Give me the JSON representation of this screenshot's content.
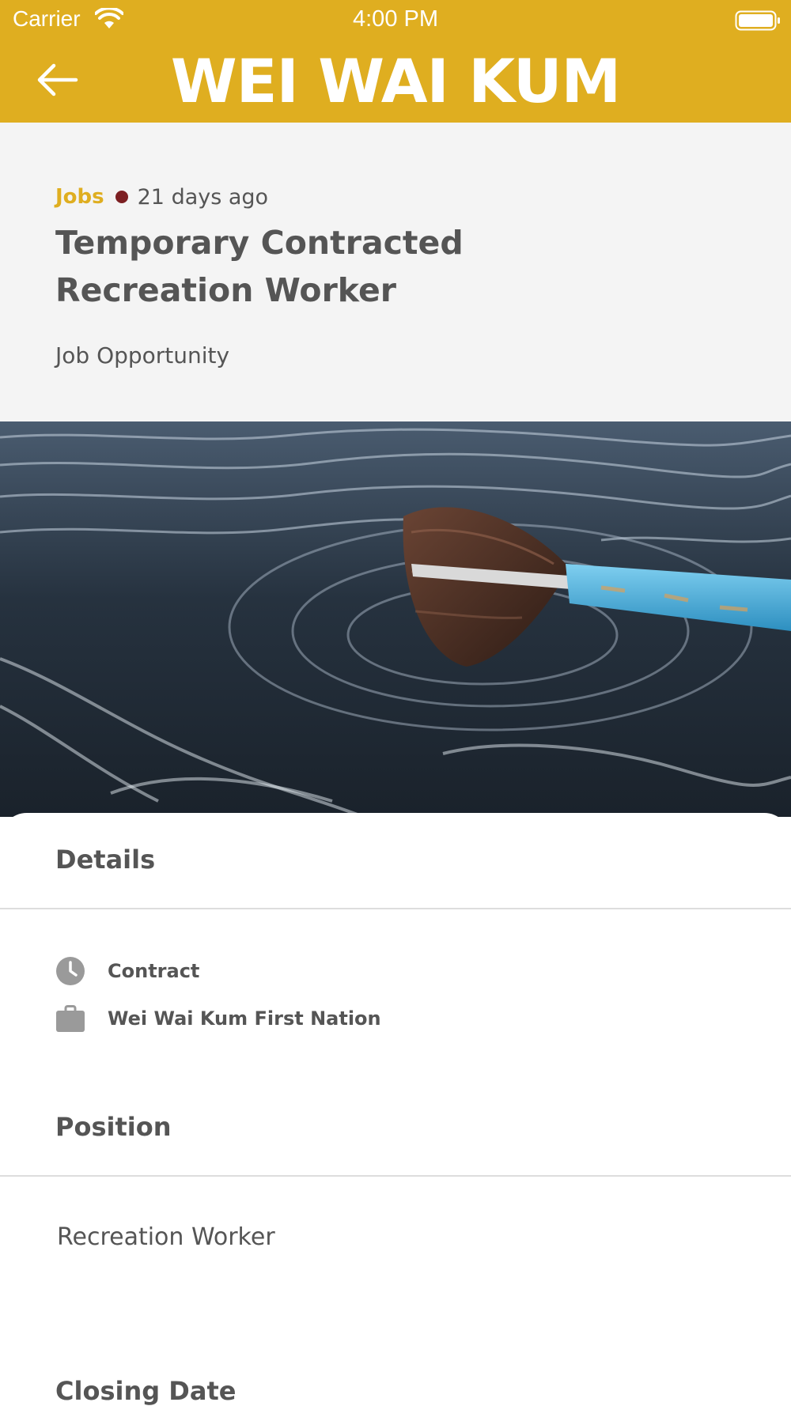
{
  "status_bar": {
    "carrier": "Carrier",
    "time": "4:00 PM"
  },
  "header": {
    "brand": "WEI WAI KUM",
    "background_color": "#DFAE20"
  },
  "post": {
    "category": "Jobs",
    "age": "21 days ago",
    "title": "Temporary Contracted Recreation Worker",
    "subtitle": "Job Opportunity",
    "category_color": "#DFAE20",
    "dot_color": "#7C1F22"
  },
  "details": {
    "heading": "Details",
    "items": [
      {
        "icon": "clock-icon",
        "label": "Contract"
      },
      {
        "icon": "briefcase-icon",
        "label": "Wei Wai Kum First Nation"
      }
    ]
  },
  "position": {
    "heading": "Position",
    "value": "Recreation Worker"
  },
  "closing_date": {
    "heading": "Closing Date"
  }
}
